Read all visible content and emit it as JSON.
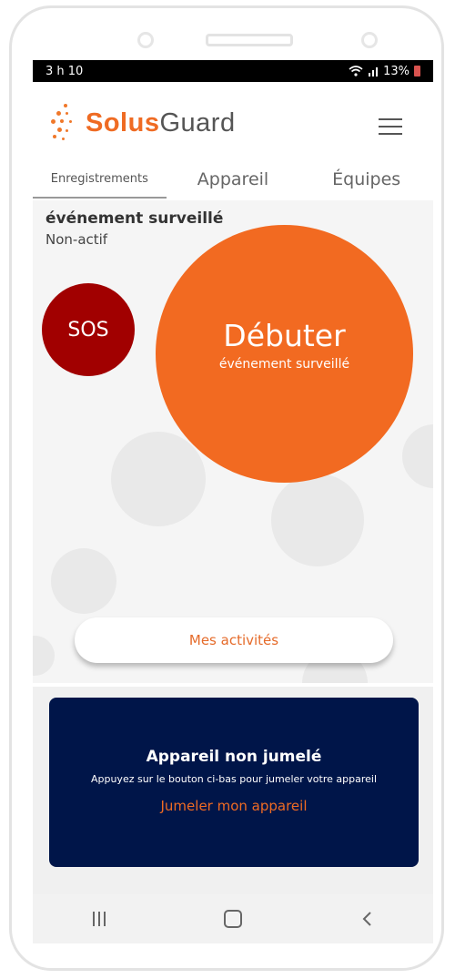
{
  "status": {
    "time": "3 h 10",
    "battery": "13%",
    "icons": [
      "wifi-icon",
      "signal-icon",
      "battery-icon"
    ]
  },
  "app": {
    "logo_part1": "Solus",
    "logo_part2": "Guard",
    "menu_icon": "hamburger-menu-icon"
  },
  "tabs": [
    {
      "label": "Enregistrements",
      "active": true
    },
    {
      "label": "Appareil",
      "active": false
    },
    {
      "label": "Équipes",
      "active": false
    }
  ],
  "event": {
    "title": "événement surveillé",
    "status": "Non-actif"
  },
  "sos": {
    "label": "SOS",
    "color": "#a10000"
  },
  "start": {
    "label": "Débuter",
    "sublabel": "événement surveillé",
    "color": "#f26a21"
  },
  "activities": {
    "label": "Mes activités"
  },
  "device_card": {
    "title": "Appareil non jumelé",
    "description": "Appuyez sur le bouton ci-bas pour jumeler votre appareil",
    "link": "Jumeler mon appareil",
    "background": "#001549"
  },
  "navbar": {
    "icons": [
      "recent-apps-icon",
      "home-icon",
      "back-icon"
    ]
  },
  "colors": {
    "accent": "#ef6b23"
  }
}
